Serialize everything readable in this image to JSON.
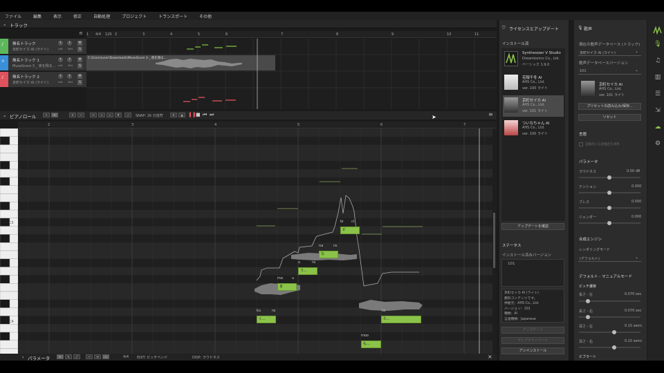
{
  "menu": [
    "ファイル",
    "編集",
    "表示",
    "修正",
    "自動処理",
    "プロジェクト",
    "トランスポート",
    "その他"
  ],
  "track_panel": {
    "title": "トラック",
    "ruler": [
      "1",
      "4/4",
      "120",
      "2",
      "3",
      "4",
      "5",
      "6",
      "7",
      "8",
      "9",
      "10",
      "11",
      "12"
    ],
    "tracks": [
      {
        "name": "無名トラック",
        "sub": "京町セイカ AI (ライト)",
        "color": "#5db85d"
      },
      {
        "name": "無名トラック 1",
        "sub": "MuseScore 3 _ 夜を翔る...",
        "color": "#3a8fd8"
      },
      {
        "name": "無名トラック 2",
        "sub": "京町セイカ AI (ライト)",
        "color": "#e0525d"
      }
    ],
    "audio_path": "C:\\Users\\user\\Downloads\\MuseScore 3 _ 夜を翔る...",
    "btn": {
      "m": "M",
      "s": "S",
      "r": "R",
      "l": "Left",
      "w": "Wht"
    }
  },
  "piano_roll": {
    "title": "ピアノロール",
    "snap": "SNAP: 16 分音符",
    "ruler": [
      "2",
      "3",
      "4",
      "5",
      "6",
      "7"
    ],
    "c5": "C5",
    "c4": "C4",
    "notes": [
      {
        "lyric": "ku",
        "phon": "く...",
        "pitch": 56
      },
      {
        "lyric": "ra",
        "phon": "",
        "pitch": 56
      },
      {
        "lyric": "ma",
        "phon": "ま",
        "pitch": 60
      },
      {
        "lyric": "u",
        "phon": "",
        "pitch": 60
      },
      {
        "lyric": "u",
        "phon": "う...",
        "pitch": 62
      },
      {
        "lyric": "ra",
        "phon": "",
        "pitch": 62
      },
      {
        "lyric": "na",
        "phon": "な",
        "pitch": 64
      },
      {
        "lyric": "ra",
        "phon": "",
        "pitch": 64
      },
      {
        "lyric": "bi",
        "phon": "ビ",
        "pitch": 67
      },
      {
        "lyric": "cl",
        "phon": "",
        "pitch": 67
      },
      {
        "lyric": "moo",
        "phon": "も...",
        "pitch": 53
      },
      {
        "lyric": "ta",
        "phon": "た...",
        "pitch": 56
      }
    ]
  },
  "param_bar": {
    "title": "パラメータ",
    "edit": "EDIT: ピッチベンド",
    "disp": "DISP: ラウドネス",
    "ratio": "4/4"
  },
  "license": {
    "title": "ライセンスとアップデート",
    "installed": "インストール済",
    "items": [
      {
        "t1": "Synthesizer V Studio",
        "t2": "Dreamtonics Co., Ltd.",
        "t3": "ベーシック 1.9.0"
      },
      {
        "t1": "花隈千冬 AI",
        "t2": "AHS Co., Ltd.",
        "t3": "ver. 100 ライト"
      },
      {
        "t1": "京町セイカ AI",
        "t2": "AHS Co., Ltd.",
        "t3": "ver. 101 ライト"
      },
      {
        "t1": "ついなちゃん AI",
        "t2": "AHS Co., Ltd.",
        "t3": "ver. 100 ライト"
      }
    ],
    "check_btn": "アップデートを確認",
    "status": "ステータス",
    "inst_ver": "インストール済みバージョン",
    "ver_val": "101",
    "info": [
      "京町セイカ AI (ライト)",
      "無料コンテンツです。",
      "供給元：AHS Co., Ltd.",
      "バージョン：101",
      "種類：AI",
      "言語種類：Japanese"
    ],
    "btn_update": "アップデート",
    "btn_deact": "ディアクティベート",
    "btn_uninst": "アンインストール"
  },
  "voice": {
    "title": "歌声",
    "db_label": "現在の歌声データベース (トラック)",
    "db_val": "京町セイカ AI (ライト)",
    "ver_label": "歌声データベースバージョン",
    "ver_val": "101",
    "card": {
      "name": "京町セイカ AI",
      "co": "AHS Co., Ltd.",
      "ver": "ver. 101 ライト"
    },
    "preset_btn": "プリセットの読み込み/保存...",
    "reset_btn": "リセット",
    "lang": "言語",
    "lang_chk": "自動的に言語推定を適用",
    "params": "パラメータ",
    "p": [
      {
        "n": "ラウドネス",
        "v": "0.00 dB"
      },
      {
        "n": "テンション",
        "v": "0.000"
      },
      {
        "n": "ブレス",
        "v": "0.000"
      },
      {
        "n": "ジェンダー",
        "v": "0.000"
      }
    ],
    "engine": "合成エンジン",
    "render": "レンダリングモード",
    "render_val": "(デフォルト)",
    "manual": "デフォルト - マニュアルモード",
    "pitch_trans": "ピッチ遷移",
    "pt": [
      {
        "n": "長さ - 左",
        "v": "0.070 sec"
      },
      {
        "n": "長さ - 右",
        "v": "0.070 sec"
      },
      {
        "n": "深さ - 左",
        "v": "0.15 semi."
      },
      {
        "n": "深さ - 右",
        "v": "0.15 semi."
      }
    ],
    "vibrato": "ビブラート"
  }
}
